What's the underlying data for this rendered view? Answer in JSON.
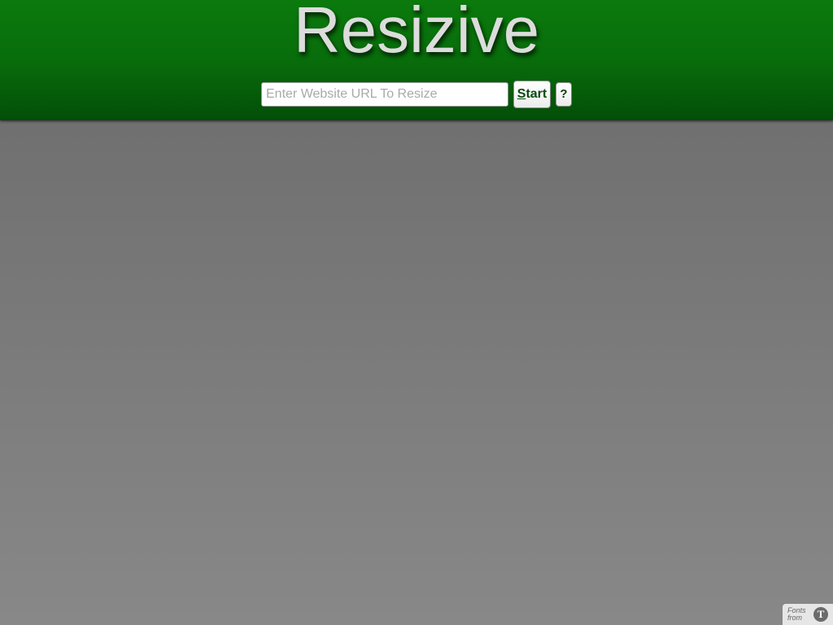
{
  "header": {
    "title": "Resizive",
    "url_placeholder": "Enter Website URL To Resize",
    "start_label_first": "S",
    "start_label_rest": "tart",
    "help_label": "?"
  },
  "footer": {
    "fonts_badge_text": "Fonts from",
    "fonts_badge_logo": "T"
  },
  "colors": {
    "header_top": "#0b7a0d",
    "header_bottom": "#034e08",
    "background_top": "#6a6a6a",
    "background_bottom": "#888888",
    "title_text": "#dcdcdc"
  },
  "icons": {
    "fonts_badge_logo": "typekit-logo-icon"
  }
}
